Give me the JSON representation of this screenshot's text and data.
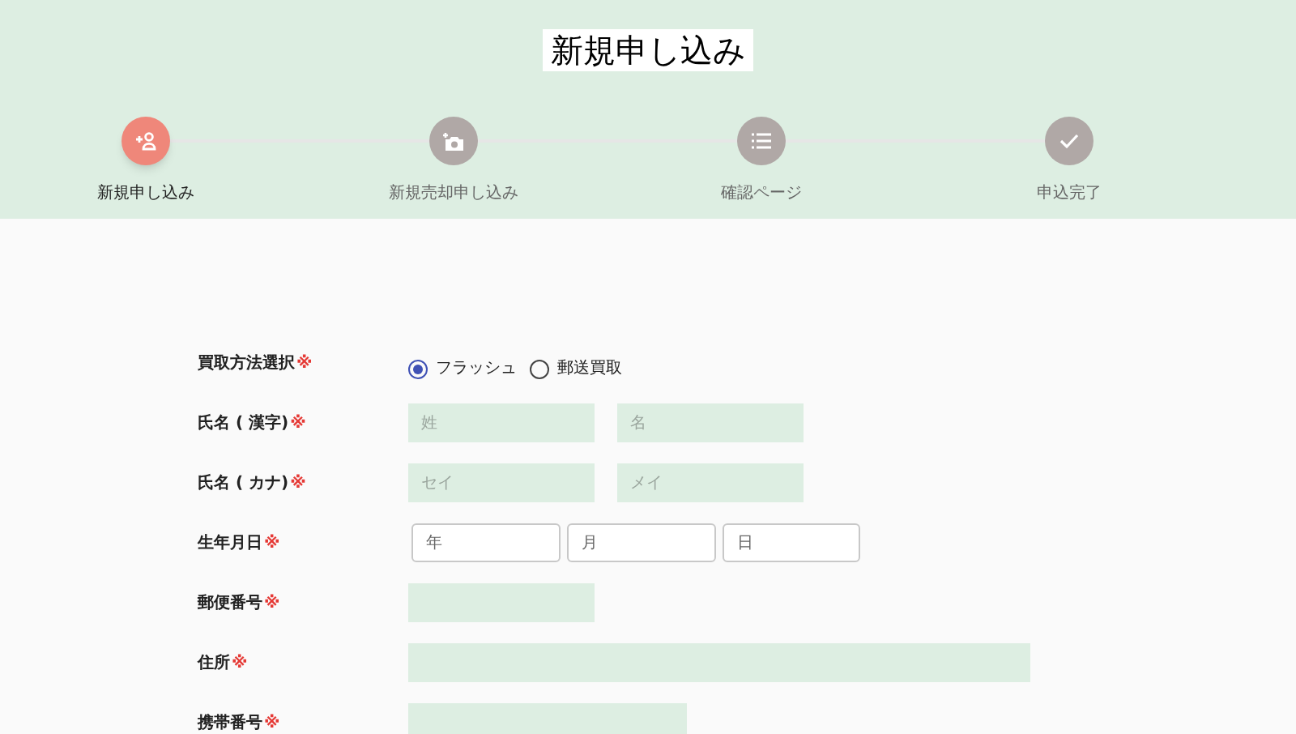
{
  "title": "新規申し込み",
  "steps": [
    {
      "label": "新規申し込み",
      "selected": true
    },
    {
      "label": "新規売却申し込み",
      "selected": false
    },
    {
      "label": "確認ページ",
      "selected": false
    },
    {
      "label": "申込完了",
      "selected": false
    }
  ],
  "form": [
    {
      "label": "買取方法選択",
      "required": "※",
      "kind": "radio",
      "options": [
        {
          "label": "フラッシュ",
          "selected": true
        },
        {
          "label": "郵送買取",
          "selected": false
        }
      ]
    },
    {
      "label": "氏名 ( 漢字)",
      "required": "※",
      "kind": "pair",
      "fields": [
        {
          "placeholder": "姓"
        },
        {
          "placeholder": "名"
        }
      ]
    },
    {
      "label": "氏名 ( カナ)",
      "required": "※",
      "kind": "pair",
      "fields": [
        {
          "placeholder": "セイ"
        },
        {
          "placeholder": "メイ"
        }
      ]
    },
    {
      "label": "生年月日",
      "required": "※",
      "kind": "date",
      "fields": [
        {
          "placeholder": "年"
        },
        {
          "placeholder": "月"
        },
        {
          "placeholder": "日"
        }
      ]
    },
    {
      "label": "郵便番号",
      "required": "※",
      "kind": "short"
    },
    {
      "label": "住所",
      "required": "※",
      "kind": "long"
    },
    {
      "label": "携帯番号",
      "required": "※",
      "kind": "medium"
    }
  ]
}
